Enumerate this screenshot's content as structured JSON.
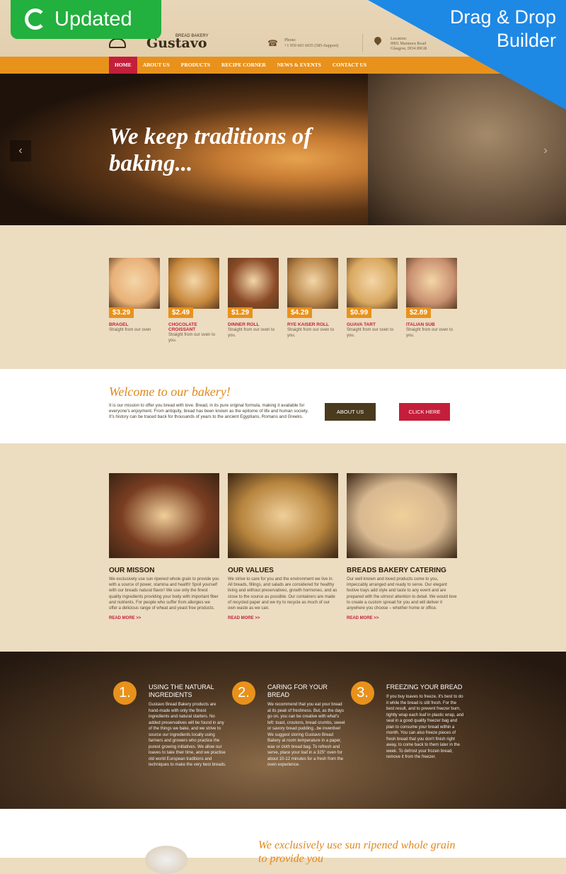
{
  "badges": {
    "updated": "Updated",
    "drag_drop": "Drag & Drop Builder"
  },
  "header": {
    "logo_sub": "BREAD BAKERY",
    "logo": "Gustavo",
    "phone_label": "Phone:",
    "phone": "+1 959 603 6035 (585-Support)",
    "location_label": "Location:",
    "location_line1": "8901 Marmora Road",
    "location_line2": "Glasgow, DO4 89GR"
  },
  "nav": [
    {
      "label": "HOME"
    },
    {
      "label": "ABOUT US"
    },
    {
      "label": "PRODUCTS"
    },
    {
      "label": "RECIPE CORNER"
    },
    {
      "label": "NEWS & EVENTS"
    },
    {
      "label": "CONTACT US"
    }
  ],
  "hero": {
    "title": "We keep traditions of baking...",
    "prev": "‹",
    "next": "›"
  },
  "products": [
    {
      "price": "$3.29",
      "name": "BRAGEL",
      "desc": "Straight from our oven",
      "color": "#e8b078"
    },
    {
      "price": "$2.49",
      "name": "CHOCOLATE CROISSANT",
      "desc": "Straight from our oven to you.",
      "color": "#c98a3e"
    },
    {
      "price": "$1.29",
      "name": "DINNER ROLL",
      "desc": "Straight from our oven to you.",
      "color": "#8a4a26"
    },
    {
      "price": "$4.29",
      "name": "RYE KAISER ROLL",
      "desc": "Straight from our oven to you.",
      "color": "#b8864a"
    },
    {
      "price": "$0.99",
      "name": "GUAVA TART",
      "desc": "Straight from our oven to you.",
      "color": "#d9a860"
    },
    {
      "price": "$2.89",
      "name": "ITALIAN SUB",
      "desc": "Straight from our oven to you.",
      "color": "#c89070"
    }
  ],
  "welcome": {
    "title": "Welcome to our bakery!",
    "text": "It is our mission to offer you bread with love. Bread, in its pure original formula, making it available for everyone's enjoyment. From antiquity, bread has been known as the epitome of life and human society. It's history can be traced back for thousands of years to the ancient Egyptians, Romans and Greeks.",
    "about_btn": "ABOUT US",
    "click_btn": "CLICK HERE"
  },
  "features": [
    {
      "title": "OUR MISSON",
      "text": "We exclusively use sun ripened whole grain to provide you with a source of power, stamina and health! Spoil yourself with our breads natural flavor! We use only the finest quality ingredients providing your body with important fiber and nutrients. For people who suffer from allergies we offer a delicious range of wheat and yeast free products.",
      "link": "READ MORE >>",
      "color": "#7a3e22"
    },
    {
      "title": "OUR VALUES",
      "text": "We strive to care for you and the environment we live in. All breads, fillings, and salads are considered for healthy living and without preservatives, growth hormones, and as close to the source as possible. Our containers are made of recycled paper and we try to recycle as much of our own waste as we can.",
      "link": "READ MORE >>",
      "color": "#b7853e"
    },
    {
      "title": "BREADS BAKERY CATERING",
      "text": "Our well known and loved products come to you, impeccably arranged and ready to serve. Our elegant festive trays add style and taste to any event and are prepared with the utmost attention to detail. We would love to create a custom spread for you and will deliver it anywhere you choose – whether home or office.",
      "link": "READ MORE >>",
      "color": "#d7b890"
    }
  ],
  "tips": [
    {
      "num": "1.",
      "title": "USING THE NATURAL INGREDIENTS",
      "text": "Gustavo Bread Bakery products are hand-made with only the finest ingredients and natural starters. No added preservatives will be found in any of the things we bake, and we strive to source our ingredients locally using farmers and growers who practice the purest growing initiatives. We allow our loaves to take their time, and we practise old world European traditions and techniques to make the very best breads."
    },
    {
      "num": "2.",
      "title": "CARING FOR YOUR BREAD",
      "text": "We recommend that you eat your bread at its peak of freshness. But, as the days go on, you can be creative with what's left: toast, croutons, bread crumbs, sweet or savory bread pudding...be inventive! We suggest storing Gustavo Bread Bakery at room temperature in a paper, wax or cloth bread bag. To refresh and serve, place your loaf in a 325° oven for about 10-12 minutes for a fresh from the oven experience."
    },
    {
      "num": "3.",
      "title": "FREEZING YOUR BREAD",
      "text": "If you buy loaves to freeze, it's best to do it while the bread is still fresh. For the best result, and to prevent freezer burn, tightly wrap each loaf in plastic wrap, and seal in a good quality freezer bag and plan to consume your bread within a month. You can also freeze pieces of fresh bread that you don't finish right away, to come back to them later in the week. To defrost your frozen bread, remove it from the freezer."
    }
  ],
  "bottom": {
    "title": "We exclusively use sun ripened whole grain to provide you"
  },
  "colors": {
    "accent": "#e8921c",
    "active": "#c41e3a",
    "about_btn": "#4a3a1e",
    "click_btn": "#c41e3a"
  }
}
